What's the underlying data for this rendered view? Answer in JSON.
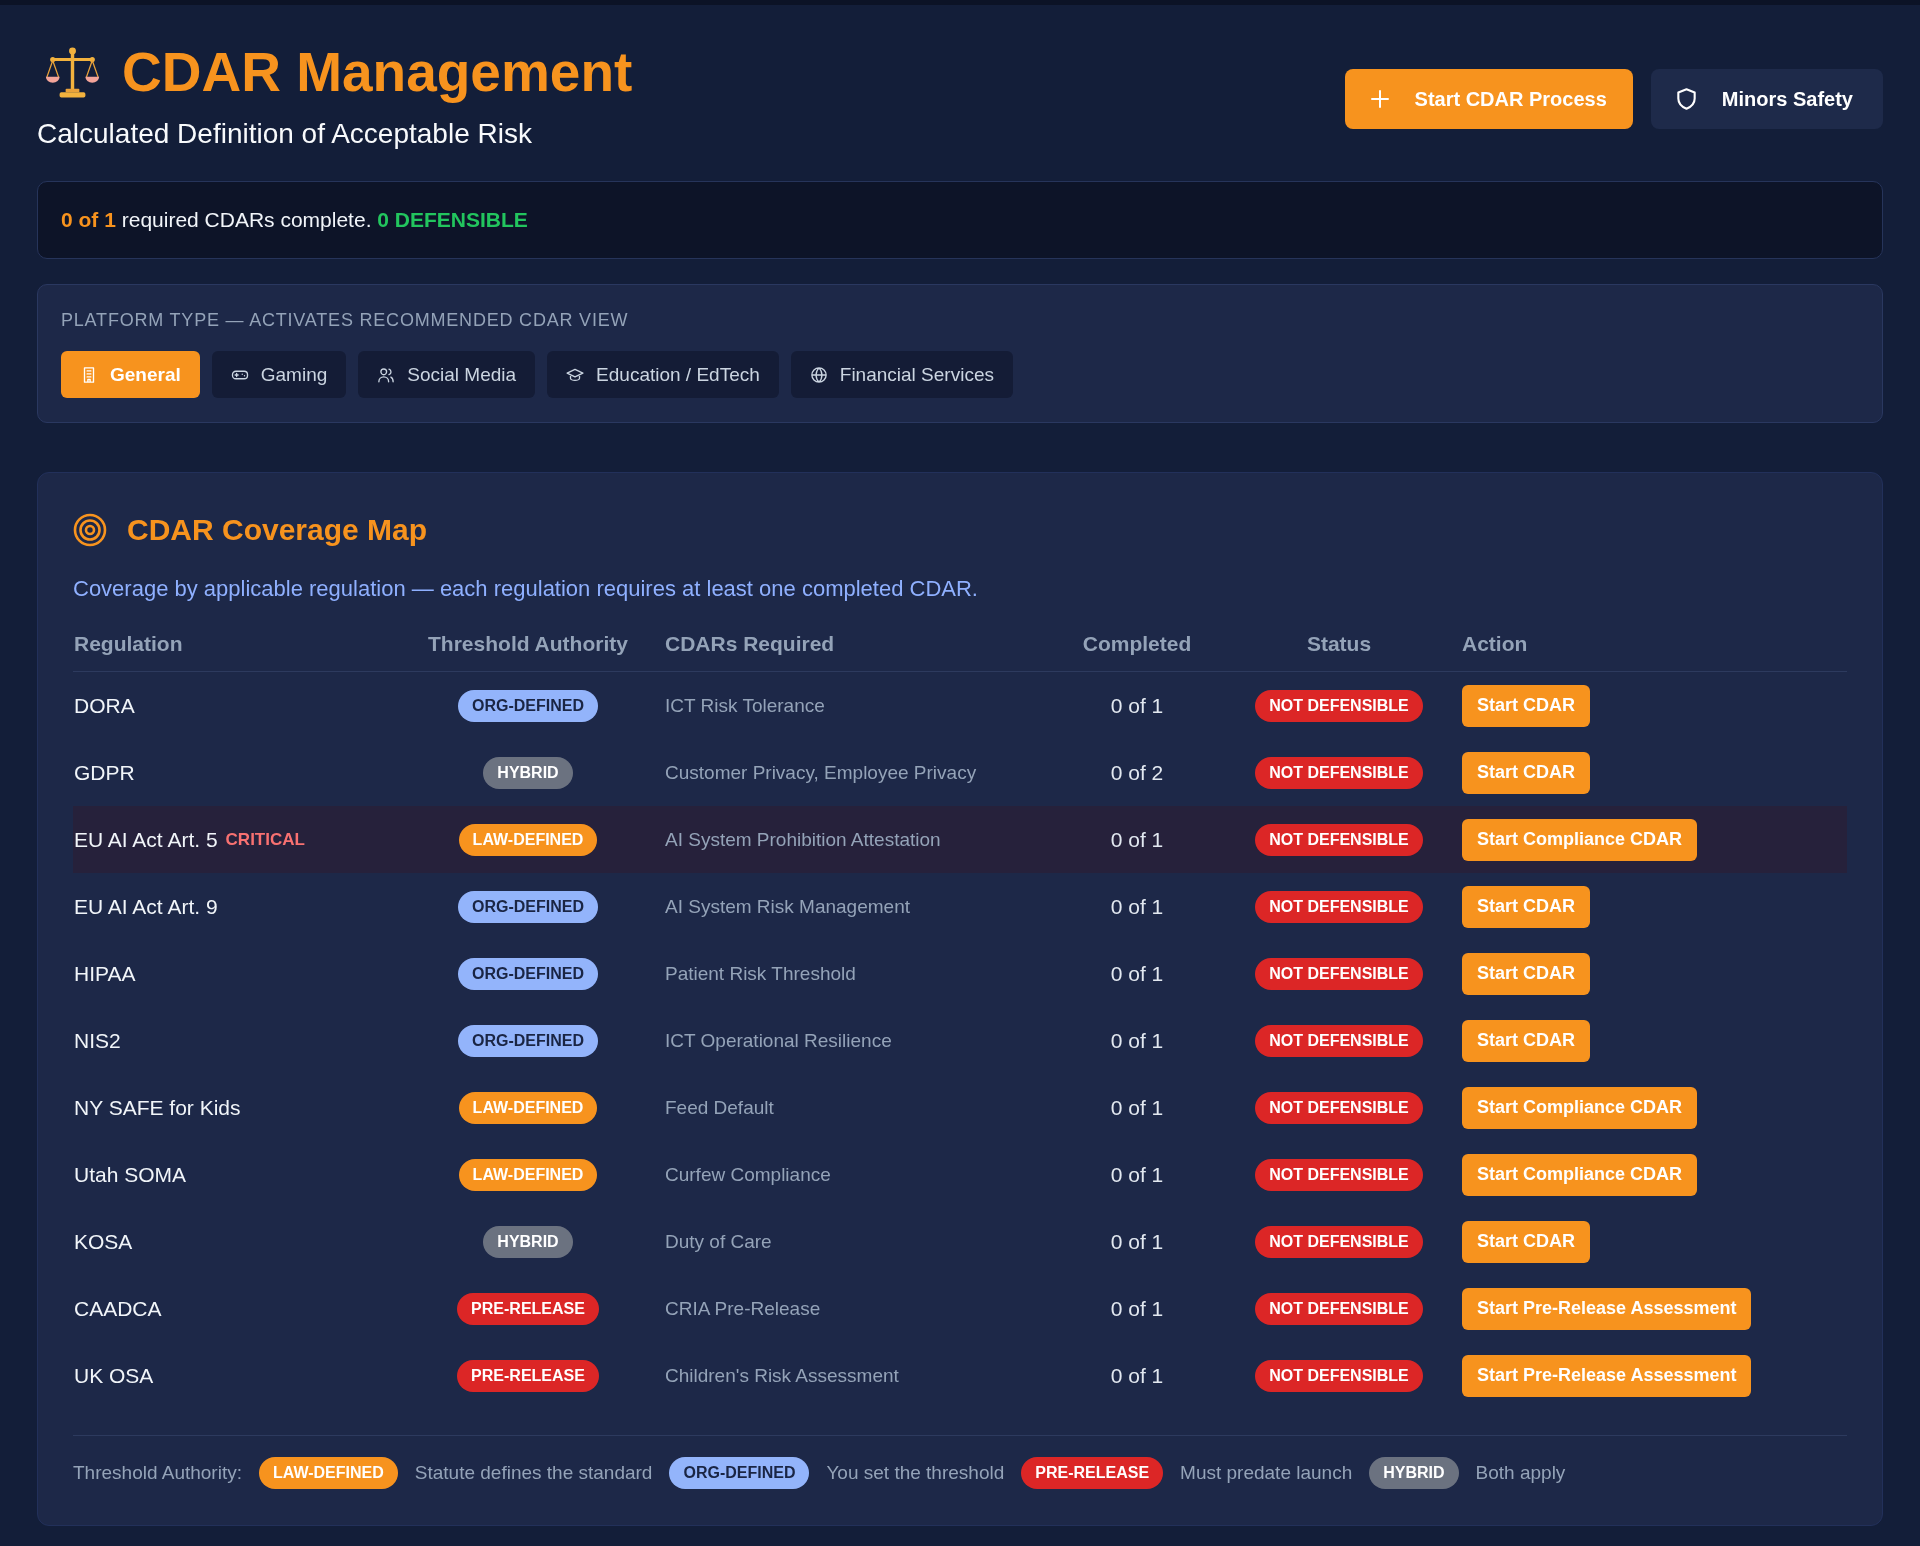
{
  "header": {
    "title": "CDAR Management",
    "subtitle": "Calculated Definition of Acceptable Risk",
    "buttons": [
      {
        "kind": "primary",
        "label": "Start CDAR Process"
      },
      {
        "kind": "secondary",
        "label": "Minors Safety"
      }
    ]
  },
  "summary": {
    "parts": [
      {
        "kind": "count",
        "text": "0 of 1"
      },
      {
        "kind": "plain",
        "text": "required CDARs complete."
      },
      {
        "kind": "positive",
        "text": "0 DEFENSIBLE"
      }
    ]
  },
  "platform": {
    "label": "PLATFORM TYPE — ACTIVATES RECOMMENDED CDAR VIEW",
    "options": [
      {
        "label": "General",
        "selected": true
      },
      {
        "label": "Gaming",
        "selected": false
      },
      {
        "label": "Social Media",
        "selected": false
      },
      {
        "label": "Education / EdTech",
        "selected": false
      },
      {
        "label": "Financial Services",
        "selected": false
      }
    ]
  },
  "coverage": {
    "title": "CDAR Coverage Map",
    "description": "Coverage by applicable regulation — each regulation requires at least one completed CDAR.",
    "columns": [
      "Regulation",
      "Threshold Authority",
      "CDARs Required",
      "Completed",
      "Status",
      "Action"
    ],
    "rows": [
      {
        "regulation": "DORA",
        "highlighted": false,
        "authority": {
          "kind": "org",
          "label": "ORG-DEFINED"
        },
        "required": "ICT Risk Tolerance",
        "completed": "0 of 1",
        "status": {
          "kind": "not_defensible",
          "label": "NOT DEFENSIBLE"
        },
        "action": "Start CDAR"
      },
      {
        "regulation": "GDPR",
        "highlighted": false,
        "authority": {
          "kind": "hybrid",
          "label": "HYBRID"
        },
        "required": "Customer Privacy, Employee Privacy",
        "completed": "0 of 2",
        "status": {
          "kind": "not_defensible",
          "label": "NOT DEFENSIBLE"
        },
        "action": "Start CDAR"
      },
      {
        "regulation": "EU AI Act Art. 5",
        "flag": "CRITICAL",
        "highlighted": true,
        "authority": {
          "kind": "law",
          "label": "LAW-DEFINED"
        },
        "required": "AI System Prohibition Attestation",
        "completed": "0 of 1",
        "status": {
          "kind": "not_defensible",
          "label": "NOT DEFENSIBLE"
        },
        "action": "Start Compliance CDAR"
      },
      {
        "regulation": "EU AI Act Art. 9",
        "highlighted": false,
        "authority": {
          "kind": "org",
          "label": "ORG-DEFINED"
        },
        "required": "AI System Risk Management",
        "completed": "0 of 1",
        "status": {
          "kind": "not_defensible",
          "label": "NOT DEFENSIBLE"
        },
        "action": "Start CDAR"
      },
      {
        "regulation": "HIPAA",
        "highlighted": false,
        "authority": {
          "kind": "org",
          "label": "ORG-DEFINED"
        },
        "required": "Patient Risk Threshold",
        "completed": "0 of 1",
        "status": {
          "kind": "not_defensible",
          "label": "NOT DEFENSIBLE"
        },
        "action": "Start CDAR"
      },
      {
        "regulation": "NIS2",
        "highlighted": false,
        "authority": {
          "kind": "org",
          "label": "ORG-DEFINED"
        },
        "required": "ICT Operational Resilience",
        "completed": "0 of 1",
        "status": {
          "kind": "not_defensible",
          "label": "NOT DEFENSIBLE"
        },
        "action": "Start CDAR"
      },
      {
        "regulation": "NY SAFE for Kids",
        "highlighted": false,
        "authority": {
          "kind": "law",
          "label": "LAW-DEFINED"
        },
        "required": "Feed Default",
        "completed": "0 of 1",
        "status": {
          "kind": "not_defensible",
          "label": "NOT DEFENSIBLE"
        },
        "action": "Start Compliance CDAR"
      },
      {
        "regulation": "Utah SOMA",
        "highlighted": false,
        "authority": {
          "kind": "law",
          "label": "LAW-DEFINED"
        },
        "required": "Curfew Compliance",
        "completed": "0 of 1",
        "status": {
          "kind": "not_defensible",
          "label": "NOT DEFENSIBLE"
        },
        "action": "Start Compliance CDAR"
      },
      {
        "regulation": "KOSA",
        "highlighted": false,
        "authority": {
          "kind": "hybrid",
          "label": "HYBRID"
        },
        "required": "Duty of Care",
        "completed": "0 of 1",
        "status": {
          "kind": "not_defensible",
          "label": "NOT DEFENSIBLE"
        },
        "action": "Start CDAR"
      },
      {
        "regulation": "CAADCA",
        "highlighted": false,
        "authority": {
          "kind": "prerelease",
          "label": "PRE-RELEASE"
        },
        "required": "CRIA Pre-Release",
        "completed": "0 of 1",
        "status": {
          "kind": "not_defensible",
          "label": "NOT DEFENSIBLE"
        },
        "action": "Start Pre-Release Assessment"
      },
      {
        "regulation": "UK OSA",
        "highlighted": false,
        "authority": {
          "kind": "prerelease",
          "label": "PRE-RELEASE"
        },
        "required": "Children's Risk Assessment",
        "completed": "0 of 1",
        "status": {
          "kind": "not_defensible",
          "label": "NOT DEFENSIBLE"
        },
        "action": "Start Pre-Release Assessment"
      }
    ],
    "legend": {
      "label": "Threshold Authority:",
      "items": [
        {
          "kind": "law",
          "label": "LAW-DEFINED",
          "description": "Statute defines the standard"
        },
        {
          "kind": "org",
          "label": "ORG-DEFINED",
          "description": "You set the threshold"
        },
        {
          "kind": "prerelease",
          "label": "PRE-RELEASE",
          "description": "Must predate launch"
        },
        {
          "kind": "hybrid",
          "label": "HYBRID",
          "description": "Both apply"
        }
      ]
    }
  }
}
